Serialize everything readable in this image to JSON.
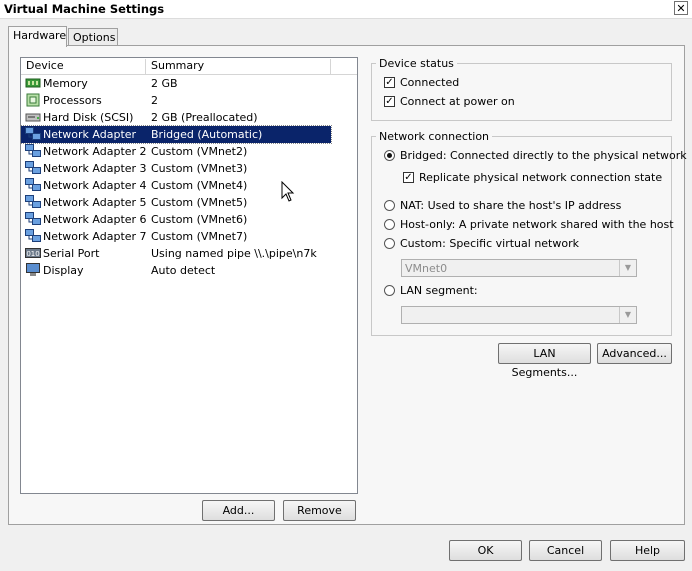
{
  "window": {
    "title": "Virtual Machine Settings",
    "close_glyph": "✕"
  },
  "tabs": [
    {
      "label": "Hardware"
    },
    {
      "label": "Options"
    }
  ],
  "device_list": {
    "columns": {
      "device": "Device",
      "summary": "Summary"
    },
    "rows": [
      {
        "icon": "memory-icon",
        "name": "Memory",
        "summary": "2 GB",
        "selected": false
      },
      {
        "icon": "processor-icon",
        "name": "Processors",
        "summary": "2",
        "selected": false
      },
      {
        "icon": "hard-disk-icon",
        "name": "Hard Disk (SCSI)",
        "summary": "2 GB (Preallocated)",
        "selected": false
      },
      {
        "icon": "network-adapter-icon",
        "name": "Network Adapter",
        "summary": "Bridged (Automatic)",
        "selected": true
      },
      {
        "icon": "network-adapter-icon",
        "name": "Network Adapter 2",
        "summary": "Custom (VMnet2)",
        "selected": false
      },
      {
        "icon": "network-adapter-icon",
        "name": "Network Adapter 3",
        "summary": "Custom (VMnet3)",
        "selected": false
      },
      {
        "icon": "network-adapter-icon",
        "name": "Network Adapter 4",
        "summary": "Custom (VMnet4)",
        "selected": false
      },
      {
        "icon": "network-adapter-icon",
        "name": "Network Adapter 5",
        "summary": "Custom (VMnet5)",
        "selected": false
      },
      {
        "icon": "network-adapter-icon",
        "name": "Network Adapter 6",
        "summary": "Custom (VMnet6)",
        "selected": false
      },
      {
        "icon": "network-adapter-icon",
        "name": "Network Adapter 7",
        "summary": "Custom (VMnet7)",
        "selected": false
      },
      {
        "icon": "serial-port-icon",
        "name": "Serial Port",
        "summary": "Using named pipe \\\\.\\pipe\\n7k",
        "selected": false
      },
      {
        "icon": "display-icon",
        "name": "Display",
        "summary": "Auto detect",
        "selected": false
      }
    ],
    "add_label": "Add...",
    "remove_label": "Remove"
  },
  "device_status": {
    "title": "Device status",
    "connected": {
      "label": "Connected",
      "checked": true
    },
    "connect_at_power_on": {
      "label": "Connect at power on",
      "checked": true
    }
  },
  "network_connection": {
    "title": "Network connection",
    "bridged": {
      "label": "Bridged: Connected directly to the physical network",
      "selected": true
    },
    "replicate": {
      "label": "Replicate physical network connection state",
      "checked": true
    },
    "nat": {
      "label": "NAT: Used to share the host's IP address",
      "selected": false
    },
    "host_only": {
      "label": "Host-only: A private network shared with the host",
      "selected": false
    },
    "custom": {
      "label": "Custom: Specific virtual network",
      "selected": false
    },
    "custom_value": "VMnet0",
    "lan_segment": {
      "label": "LAN segment:",
      "selected": false
    },
    "lan_segment_value": "",
    "lan_segments_button": "LAN Segments...",
    "advanced_button": "Advanced..."
  },
  "footer": {
    "ok": "OK",
    "cancel": "Cancel",
    "help": "Help"
  },
  "checkmark": "✓"
}
